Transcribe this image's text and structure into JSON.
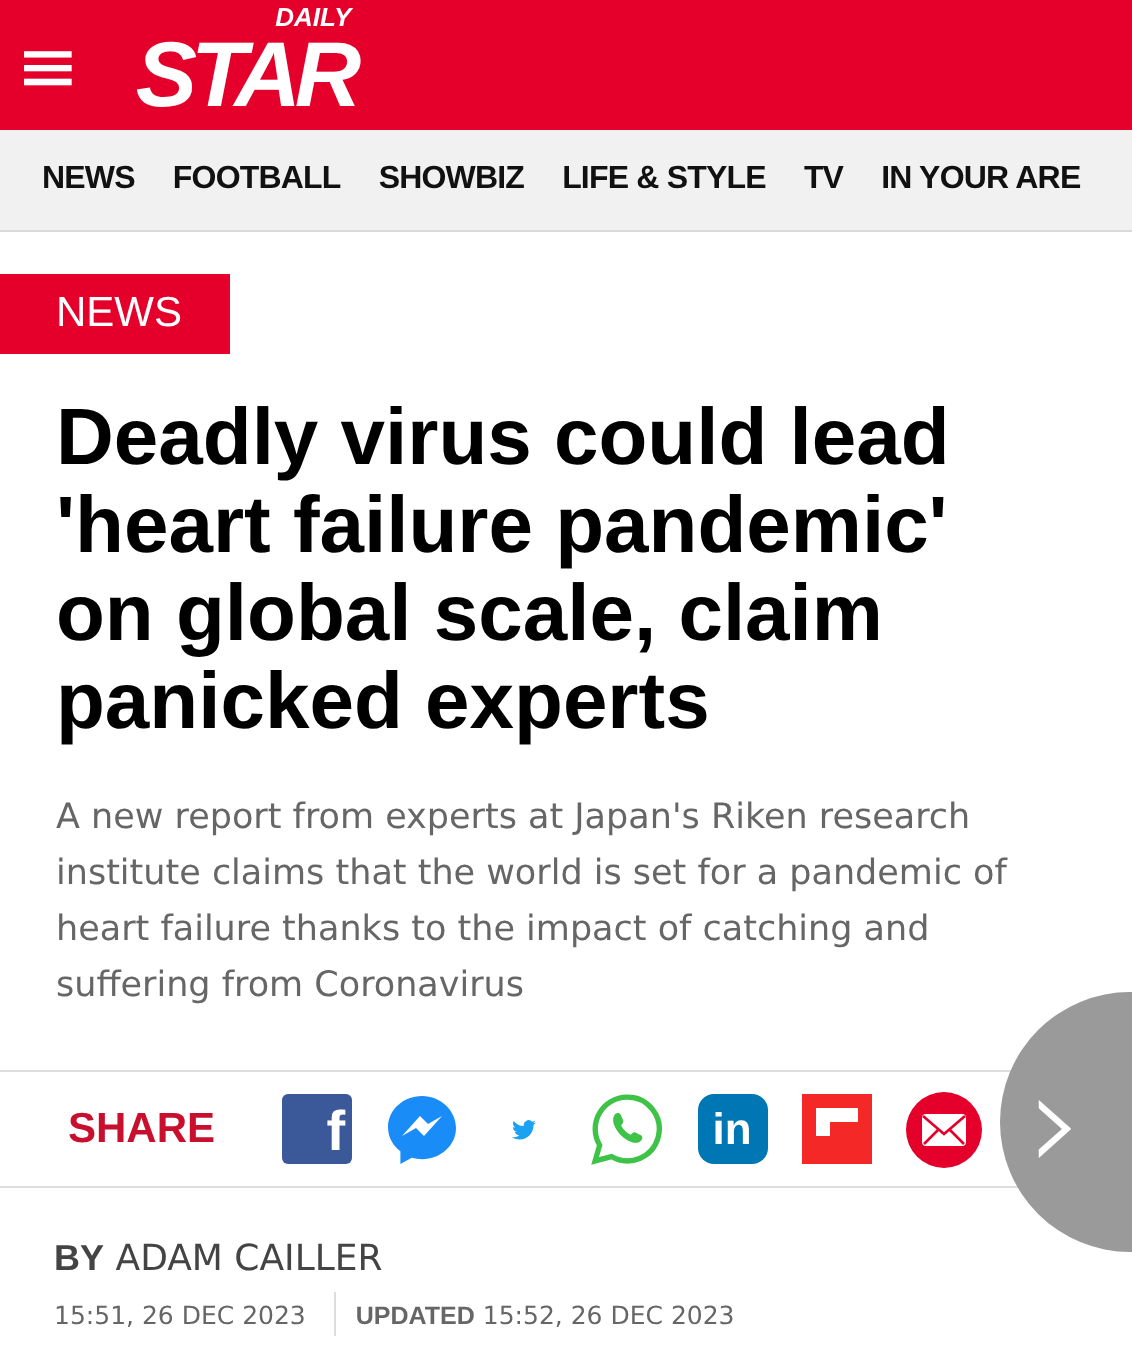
{
  "header": {
    "menu_icon": "≡",
    "logo_small": "DAILY",
    "logo_big": "STAR"
  },
  "nav": [
    "NEWS",
    "FOOTBALL",
    "SHOWBIZ",
    "LIFE & STYLE",
    "TV",
    "IN YOUR ARE"
  ],
  "article": {
    "section": "NEWS",
    "headline": "Deadly virus could lead 'heart failure pandemic' on global scale, claim panicked experts",
    "summary": "A new report from experts at Japan's Riken research institute claims that the world is set for a pandemic of heart failure thanks to the impact of catching and suffering from Coronavirus"
  },
  "share": {
    "label": "SHARE",
    "buttons": [
      {
        "kind": "facebook",
        "glyph": "f"
      },
      {
        "kind": "messenger"
      },
      {
        "kind": "twitter"
      },
      {
        "kind": "whatsapp"
      },
      {
        "kind": "linkedin",
        "glyph": "in"
      },
      {
        "kind": "flipboard"
      },
      {
        "kind": "email"
      }
    ]
  },
  "byline": {
    "prefix": "BY",
    "author": "ADAM CAILLER",
    "published": "15:51, 26 DEC 2023",
    "updated_label": "UPDATED",
    "updated": "15:52, 26 DEC 2023"
  },
  "next_button": "›"
}
